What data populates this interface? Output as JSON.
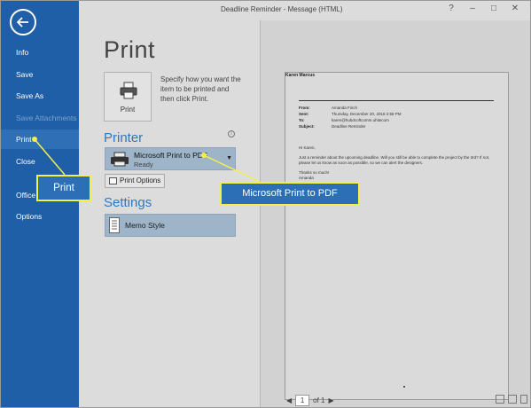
{
  "window": {
    "title": "Deadline Reminder - Message (HTML)",
    "help": "?",
    "minimize": "–",
    "restore": "□",
    "close": "✕"
  },
  "sidebar": {
    "items": [
      {
        "label": "Info",
        "state": "normal"
      },
      {
        "label": "Save",
        "state": "normal"
      },
      {
        "label": "Save As",
        "state": "normal"
      },
      {
        "label": "Save Attachments",
        "state": "disabled"
      },
      {
        "label": "Print",
        "state": "selected"
      },
      {
        "label": "Close",
        "state": "normal"
      },
      {
        "label": "Office",
        "state": "normal"
      },
      {
        "label": "Options",
        "state": "normal"
      }
    ]
  },
  "print": {
    "title": "Print",
    "button_label": "Print",
    "description": "Specify how you want the item to be printed and then click Print."
  },
  "printer": {
    "heading": "Printer",
    "info_icon": "i",
    "name": "Microsoft Print to PDF",
    "status": "Ready",
    "options_label": "Print Options"
  },
  "settings": {
    "heading": "Settings",
    "style": "Memo Style"
  },
  "preview": {
    "sender": "Karen Marcus",
    "headers": [
      {
        "label": "From:",
        "value": "Amanda Finch"
      },
      {
        "label": "Sent:",
        "value": "Thursday, December 20, 2018 2:58 PM"
      },
      {
        "label": "To:",
        "value": "karen@hubdcoftcomm.uhitecom"
      },
      {
        "label": "Subject:",
        "value": "Deadline Reminder"
      }
    ],
    "greeting": "Hi Karen,",
    "body": "Just a reminder about the upcoming deadline. Will you still be able to complete the project by the 3rd? If not, please let us know as soon as possible, so we can alert the designers.",
    "signoff": "Thanks so much!",
    "signature": "Amanda"
  },
  "page_nav": {
    "current": "1",
    "of": "of 1"
  },
  "callouts": {
    "print": "Print",
    "printer": "Microsoft Print to PDF"
  },
  "colors": {
    "sidebar": "#1f5fa8",
    "accent": "#2b79c2",
    "callout_border": "#f4f04a"
  }
}
